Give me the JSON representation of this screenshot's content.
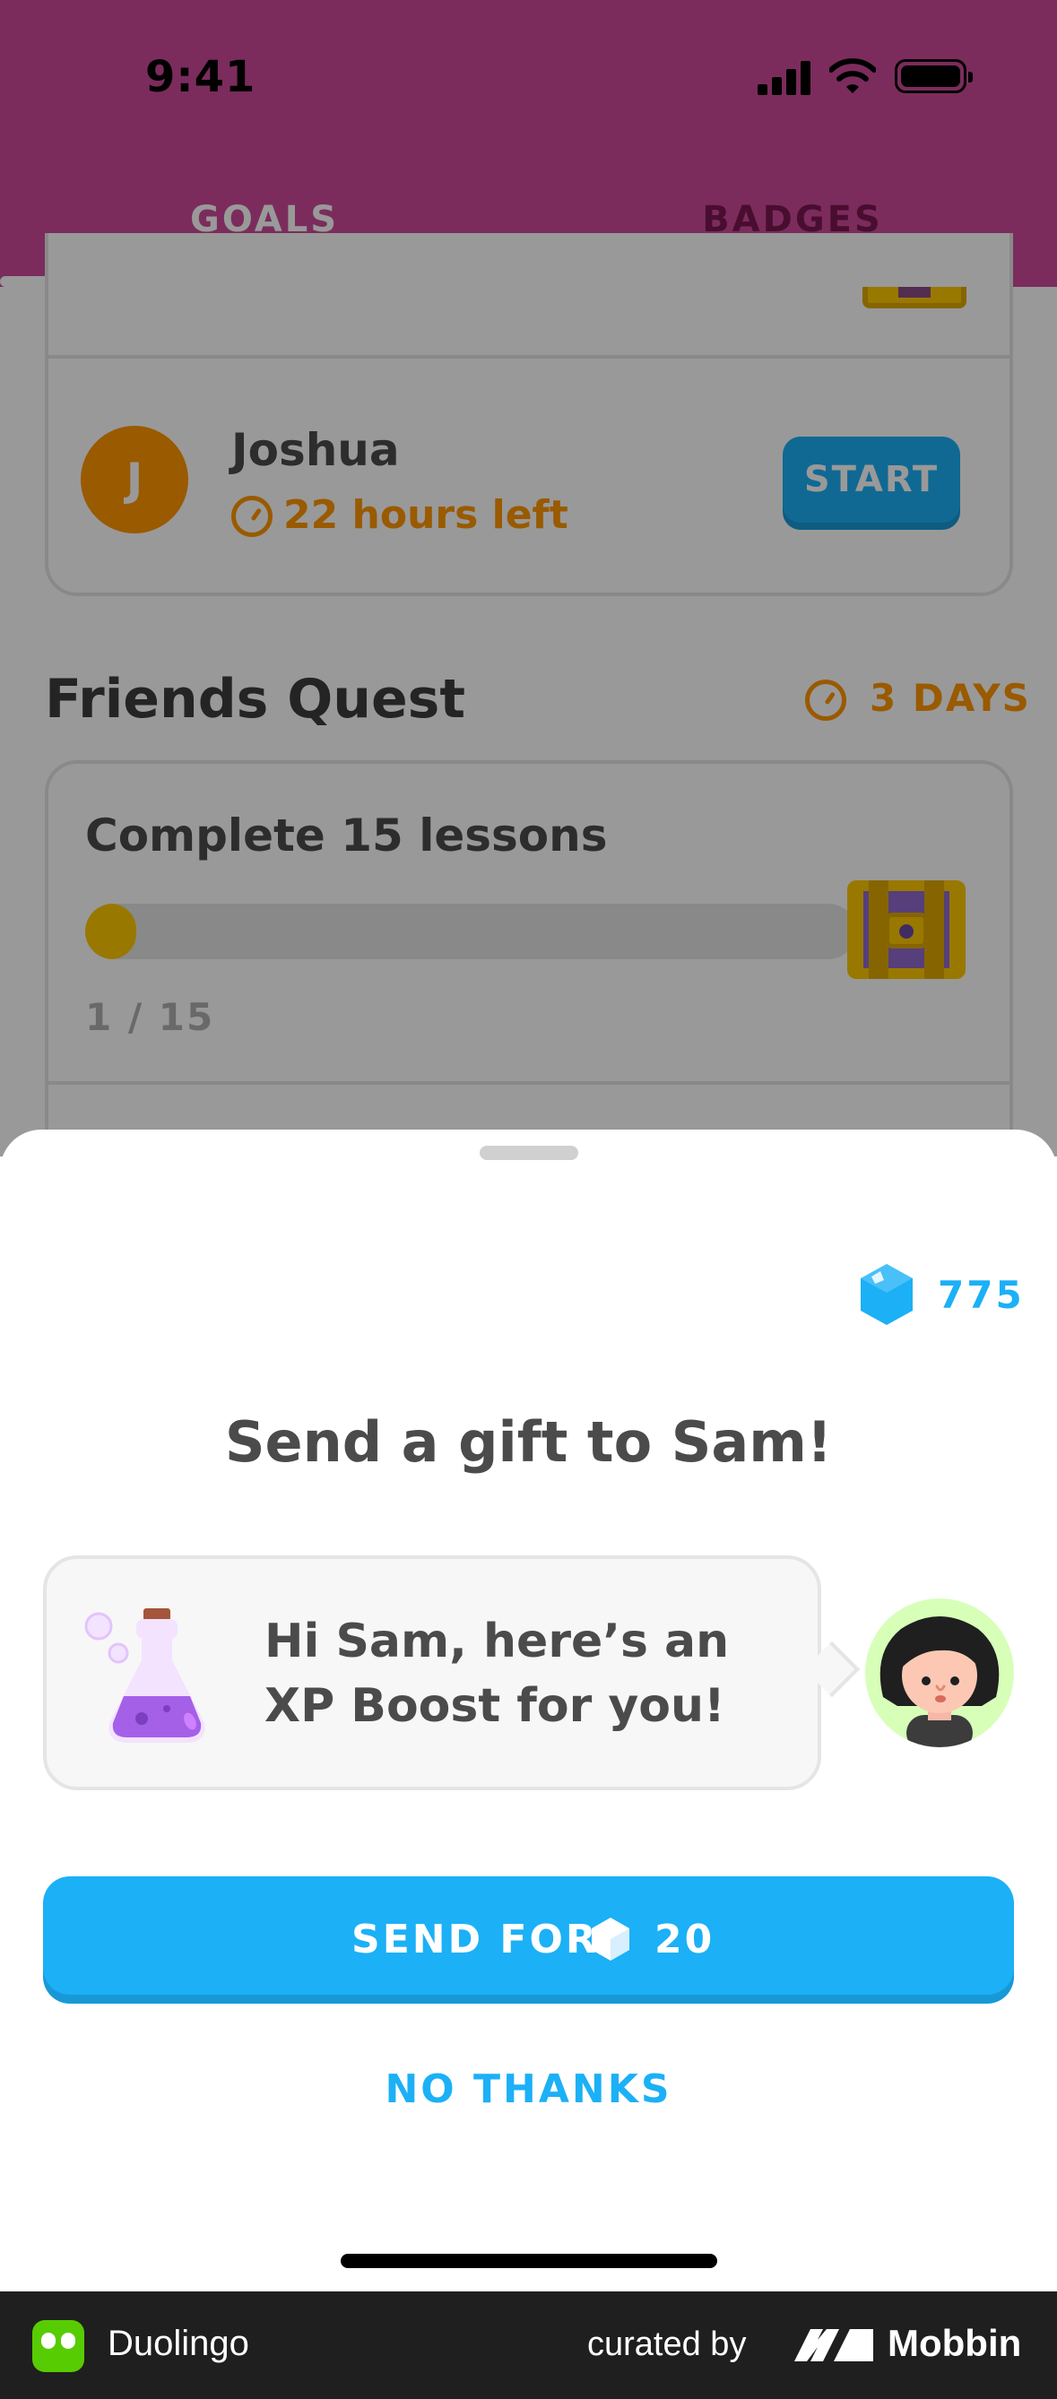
{
  "status_bar": {
    "time": "9:41"
  },
  "tabs": [
    {
      "label": "GOALS",
      "active": true
    },
    {
      "label": "BADGES",
      "active": false
    }
  ],
  "friend_card": {
    "avatar_initial": "J",
    "name": "Joshua",
    "time_left": "22 hours left",
    "start_label": "START"
  },
  "friends_quest": {
    "title": "Friends Quest",
    "time_left": "3 DAYS",
    "quest": {
      "title": "Complete 15 lessons",
      "progress": 1,
      "total": 15,
      "progress_label": "1 / 15"
    }
  },
  "gift_sheet": {
    "gem_balance": "775",
    "title": "Send a gift to Sam!",
    "message": "Hi Sam, here’s an XP Boost for you!",
    "send_label": "SEND FOR",
    "send_price": "20",
    "dismiss_label": "NO THANKS"
  },
  "footer": {
    "app_name": "Duolingo",
    "curated_by": "curated by",
    "brand": "Mobbin"
  },
  "colors": {
    "accent_blue": "#1cb0f6",
    "orange": "#ff9600",
    "header_magenta": "#cd4a9a",
    "gold": "#ffc800"
  },
  "icons": [
    "signal-icon",
    "wifi-icon",
    "battery-icon",
    "clock-icon",
    "chest-icon",
    "gem-icon",
    "potion-icon",
    "avatar-icon",
    "duolingo-logo",
    "mobbin-logo"
  ]
}
